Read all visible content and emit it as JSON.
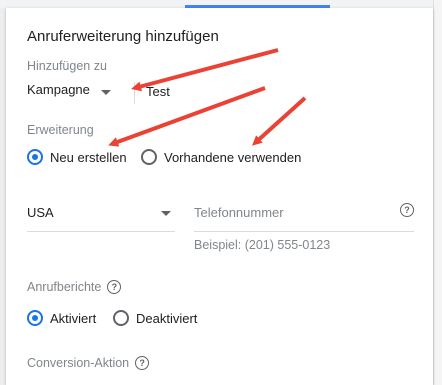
{
  "dialog": {
    "title": "Anruferweiterung hinzufügen"
  },
  "add_to": {
    "label": "Hinzufügen zu",
    "level_value": "Kampagne",
    "campaign_value": "Test"
  },
  "extension": {
    "label": "Erweiterung",
    "options": [
      {
        "label": "Neu erstellen",
        "selected": true
      },
      {
        "label": "Vorhandene verwenden",
        "selected": false
      }
    ]
  },
  "phone": {
    "country_value": "USA",
    "number_placeholder": "Telefonnummer",
    "example": "Beispiel: (201) 555-0123"
  },
  "call_reporting": {
    "label": "Anrufberichte",
    "options": [
      {
        "label": "Aktiviert",
        "selected": true
      },
      {
        "label": "Deaktiviert",
        "selected": false
      }
    ]
  },
  "conversion": {
    "label": "Conversion-Aktion"
  },
  "colors": {
    "accent": "#1a73e8",
    "annotation": "#ea4335"
  },
  "icons": {
    "help": "help-circle-icon",
    "dropdown": "chevron-down-icon"
  },
  "annotations": {
    "count": 3,
    "description": "red arrows pointing to Kampagne dropdown, Neu erstellen radio, Vorhandene verwenden radio"
  }
}
